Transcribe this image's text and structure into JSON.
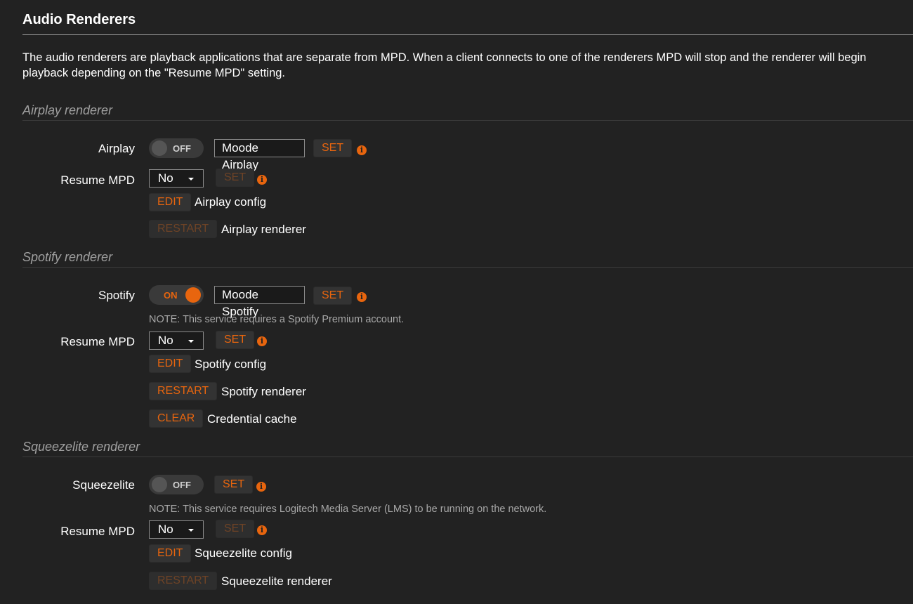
{
  "page": {
    "title": "Audio Renderers",
    "intro_line1": "The audio renderers are playback applications that are separate from MPD. When a client connects to one of the renderers MPD will stop and the renderer will begin",
    "intro_line2": "playback depending on the \"Resume MPD\" setting."
  },
  "colors": {
    "accent": "#e8650e",
    "background": "#222222",
    "muted_text": "#a0a0a0"
  },
  "airplay": {
    "section_title": "Airplay renderer",
    "label": "Airplay",
    "toggle_state": "OFF",
    "name_value": "Moode Airplay",
    "set_label": "SET",
    "resume_label": "Resume MPD",
    "resume_value": "No",
    "resume_set_label": "SET",
    "edit_label": "EDIT",
    "edit_text": "Airplay config",
    "restart_label": "RESTART",
    "restart_text": "Airplay renderer"
  },
  "spotify": {
    "section_title": "Spotify renderer",
    "label": "Spotify",
    "toggle_state": "ON",
    "name_value": "Moode Spotify",
    "set_label": "SET",
    "note": "NOTE: This service requires a Spotify Premium account.",
    "resume_label": "Resume MPD",
    "resume_value": "No",
    "resume_set_label": "SET",
    "edit_label": "EDIT",
    "edit_text": "Spotify config",
    "restart_label": "RESTART",
    "restart_text": "Spotify renderer",
    "clear_label": "CLEAR",
    "clear_text": "Credential cache"
  },
  "squeezelite": {
    "section_title": "Squeezelite renderer",
    "label": "Squeezelite",
    "toggle_state": "OFF",
    "set_label": "SET",
    "note": "NOTE: This service requires Logitech Media Server (LMS) to be running on the network.",
    "resume_label": "Resume MPD",
    "resume_value": "No",
    "resume_set_label": "SET",
    "edit_label": "EDIT",
    "edit_text": "Squeezelite config",
    "restart_label": "RESTART",
    "restart_text": "Squeezelite renderer"
  },
  "icons": {
    "info": "i"
  }
}
